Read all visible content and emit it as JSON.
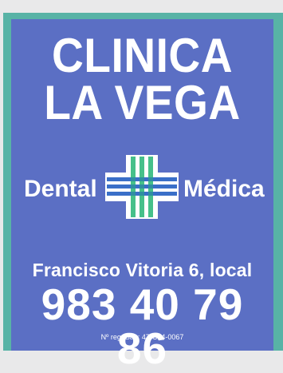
{
  "sign": {
    "title_line1": "CLINICA",
    "title_line2": "LA VEGA",
    "left_word": "Dental",
    "right_word": "Médica",
    "address": "Francisco Vitoria 6, local",
    "phone": "983 40 79 86",
    "registration": "Nº reg. San: 47-C24-0067"
  },
  "colors": {
    "background": "#e9e9ea",
    "border_teal": "#58b3a6",
    "panel_blue": "#5b6fc4",
    "text": "#ffffff",
    "logo_green": "#46c08a",
    "logo_blue": "#3a6fc8"
  }
}
